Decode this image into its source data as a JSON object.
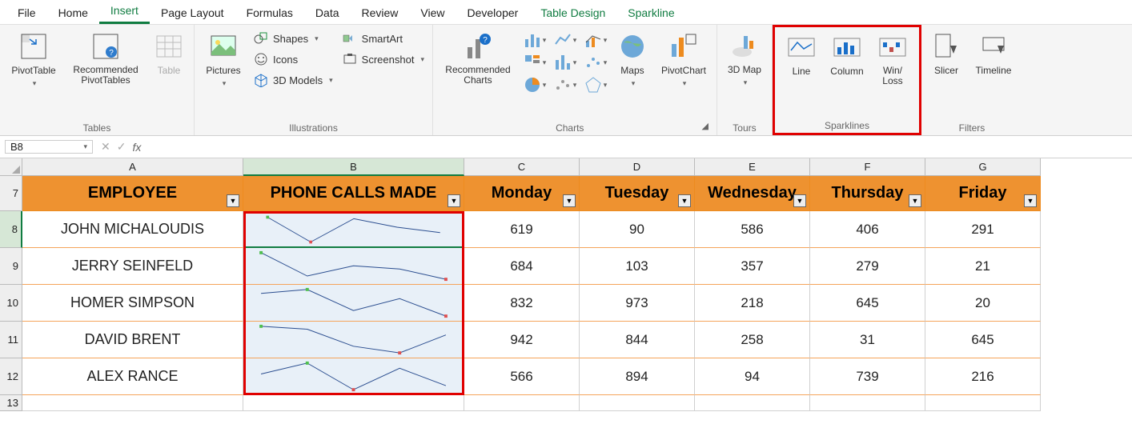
{
  "tabs": {
    "file": "File",
    "home": "Home",
    "insert": "Insert",
    "page_layout": "Page Layout",
    "formulas": "Formulas",
    "data": "Data",
    "review": "Review",
    "view": "View",
    "developer": "Developer",
    "table_design": "Table Design",
    "sparkline": "Sparkline"
  },
  "ribbon": {
    "tables": {
      "label": "Tables",
      "pivot": "PivotTable",
      "rec_pivot": "Recommended PivotTables",
      "table": "Table"
    },
    "illustrations": {
      "label": "Illustrations",
      "pictures": "Pictures",
      "shapes": "Shapes",
      "icons": "Icons",
      "models": "3D Models",
      "smartart": "SmartArt",
      "screenshot": "Screenshot"
    },
    "charts": {
      "label": "Charts",
      "rec_charts": "Recommended Charts",
      "maps": "Maps",
      "pivotchart": "PivotChart"
    },
    "tours": {
      "label": "Tours",
      "map3d": "3D Map"
    },
    "sparklines": {
      "label": "Sparklines",
      "line": "Line",
      "column": "Column",
      "winloss": "Win/\nLoss"
    },
    "filters": {
      "label": "Filters",
      "slicer": "Slicer",
      "timeline": "Timeline"
    }
  },
  "name_box": "B8",
  "sheet": {
    "cols": [
      "A",
      "B",
      "C",
      "D",
      "E",
      "F",
      "G"
    ],
    "row_nums": [
      "7",
      "8",
      "9",
      "10",
      "11",
      "12",
      "13"
    ],
    "headers": {
      "employee": "EMPLOYEE",
      "phone": "PHONE CALLS MADE",
      "mon": "Monday",
      "tue": "Tuesday",
      "wed": "Wednesday",
      "thu": "Thursday",
      "fri": "Friday"
    },
    "rows": [
      {
        "name": "JOHN MICHALOUDIS",
        "vals": [
          "619",
          "90",
          "586",
          "406",
          "291"
        ]
      },
      {
        "name": "JERRY SEINFELD",
        "vals": [
          "684",
          "103",
          "357",
          "279",
          "21"
        ]
      },
      {
        "name": "HOMER SIMPSON",
        "vals": [
          "832",
          "973",
          "218",
          "645",
          "20"
        ]
      },
      {
        "name": "DAVID BRENT",
        "vals": [
          "942",
          "844",
          "258",
          "31",
          "645"
        ]
      },
      {
        "name": "ALEX RANCE",
        "vals": [
          "566",
          "894",
          "94",
          "739",
          "216"
        ]
      }
    ]
  },
  "chart_data": [
    {
      "type": "line",
      "series_name": "JOHN MICHALOUDIS",
      "x": [
        "Mon",
        "Tue",
        "Wed",
        "Thu",
        "Fri"
      ],
      "values": [
        619,
        90,
        586,
        406,
        291
      ],
      "high_index": 0,
      "low_index": 1
    },
    {
      "type": "line",
      "series_name": "JERRY SEINFELD",
      "x": [
        "Mon",
        "Tue",
        "Wed",
        "Thu",
        "Fri"
      ],
      "values": [
        684,
        103,
        357,
        279,
        21
      ],
      "high_index": 0,
      "low_index": 4
    },
    {
      "type": "line",
      "series_name": "HOMER SIMPSON",
      "x": [
        "Mon",
        "Tue",
        "Wed",
        "Thu",
        "Fri"
      ],
      "values": [
        832,
        973,
        218,
        645,
        20
      ],
      "high_index": 1,
      "low_index": 4
    },
    {
      "type": "line",
      "series_name": "DAVID BRENT",
      "x": [
        "Mon",
        "Tue",
        "Wed",
        "Thu",
        "Fri"
      ],
      "values": [
        942,
        844,
        258,
        31,
        645
      ],
      "high_index": 0,
      "low_index": 3
    },
    {
      "type": "line",
      "series_name": "ALEX RANCE",
      "x": [
        "Mon",
        "Tue",
        "Wed",
        "Thu",
        "Fri"
      ],
      "values": [
        566,
        894,
        94,
        739,
        216
      ],
      "high_index": 1,
      "low_index": 2
    }
  ]
}
